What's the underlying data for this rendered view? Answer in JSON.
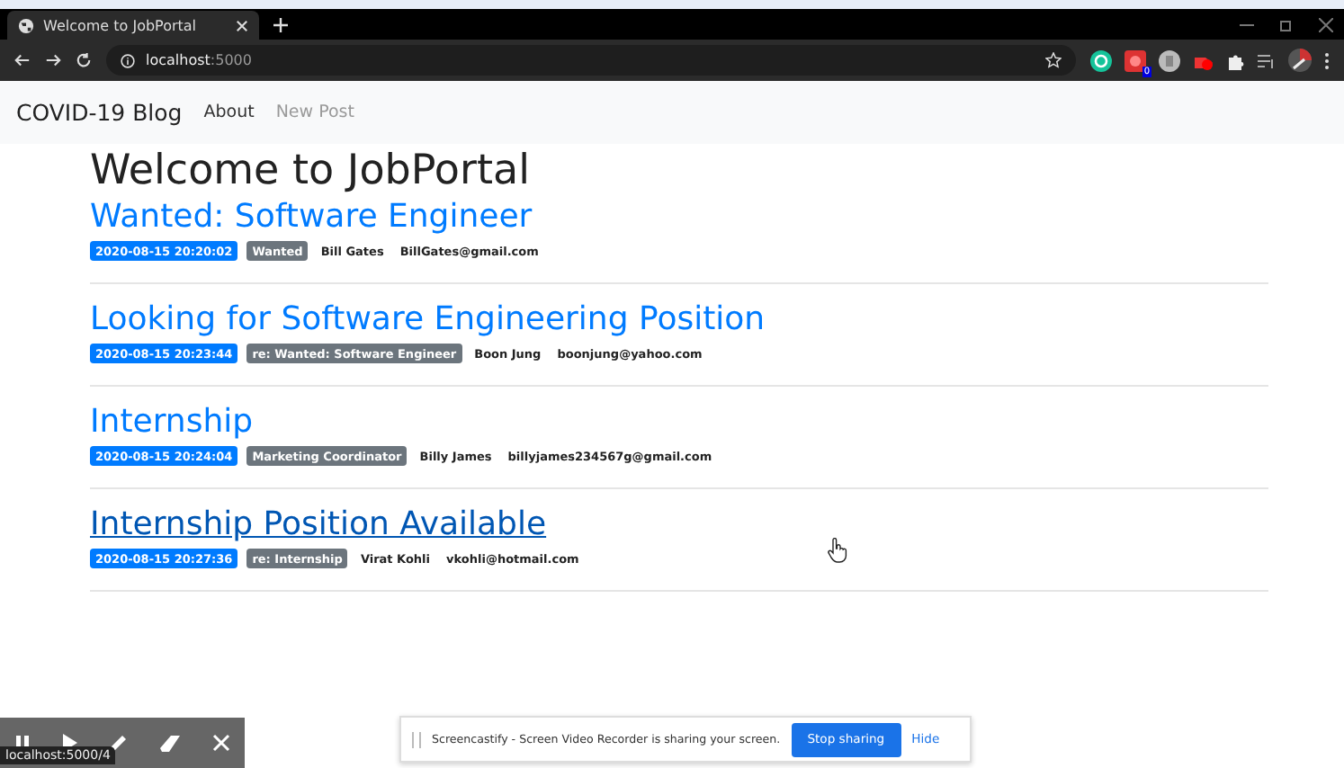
{
  "browser": {
    "tab_title": "Welcome to JobPortal",
    "url_host": "localhost",
    "url_port": ":5000",
    "extension_badge": "0"
  },
  "navbar": {
    "brand": "COVID-19 Blog",
    "links": [
      {
        "label": "About",
        "disabled": false
      },
      {
        "label": "New Post",
        "disabled": true
      }
    ]
  },
  "heading": "Welcome to JobPortal",
  "posts": [
    {
      "title": "Wanted: Software Engineer",
      "hovered": false,
      "date": "2020-08-15 20:20:02",
      "tag": "Wanted",
      "author": "Bill Gates",
      "email": "BillGates@gmail.com"
    },
    {
      "title": "Looking for Software Engineering Position",
      "hovered": false,
      "date": "2020-08-15 20:23:44",
      "tag": "re: Wanted: Software Engineer",
      "author": "Boon Jung",
      "email": "boonjung@yahoo.com"
    },
    {
      "title": "Internship",
      "hovered": false,
      "date": "2020-08-15 20:24:04",
      "tag": "Marketing Coordinator",
      "author": "Billy James",
      "email": "billyjames234567g@gmail.com"
    },
    {
      "title": "Internship Position Available",
      "hovered": true,
      "date": "2020-08-15 20:27:36",
      "tag": "re: Internship",
      "author": "Virat Kohli",
      "email": "vkohli@hotmail.com"
    }
  ],
  "status_url": "localhost:5000/4",
  "share_bar": {
    "message": "Screencastify - Screen Video Recorder is sharing your screen.",
    "stop_button": "Stop sharing",
    "hide_link": "Hide"
  }
}
